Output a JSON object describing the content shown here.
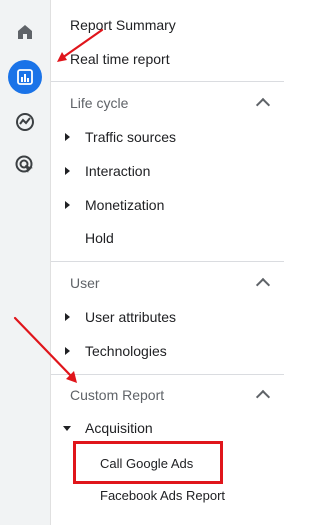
{
  "rail": {
    "icons": [
      "home-icon",
      "reports-icon",
      "explore-icon",
      "advertising-icon"
    ],
    "active": "reports-icon",
    "accent": "#1a73e8"
  },
  "nav": {
    "report_summary": "Report Summary",
    "real_time_report": "Real time report",
    "life_cycle": {
      "title": "Life cycle",
      "items": [
        "Traffic sources",
        "Interaction",
        "Monetization",
        "Hold"
      ]
    },
    "user": {
      "title": "User",
      "items": [
        "User attributes",
        "Technologies"
      ]
    },
    "custom_report": {
      "title": "Custom Report",
      "acquisition": "Acquisition",
      "sub_items": [
        "Call Google Ads",
        "Facebook Ads Report"
      ]
    }
  },
  "annotations": {
    "color": "#e0151b"
  }
}
